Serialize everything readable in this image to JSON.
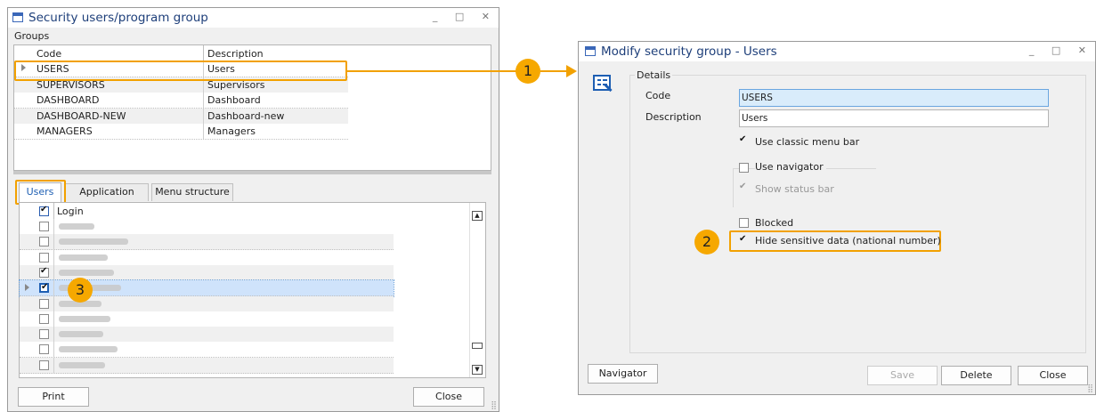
{
  "left_window": {
    "title": "Security users/program group",
    "groups_label": "Groups",
    "columns": [
      "Code",
      "Description"
    ],
    "rows": [
      {
        "code": "USERS",
        "description": "Users"
      },
      {
        "code": "SUPERVISORS",
        "description": "Supervisors"
      },
      {
        "code": "DASHBOARD",
        "description": "Dashboard"
      },
      {
        "code": "DASHBOARD-NEW",
        "description": "Dashboard-new"
      },
      {
        "code": "MANAGERS",
        "description": "Managers"
      }
    ],
    "tabs": [
      {
        "label": "Users"
      },
      {
        "label": "Application rights"
      },
      {
        "label": "Menu structure"
      }
    ],
    "users_column": "Login",
    "user_checks": [
      false,
      false,
      false,
      true,
      true,
      false,
      false,
      false,
      false,
      false
    ],
    "print_label": "Print",
    "close_label": "Close"
  },
  "right_window": {
    "title": "Modify security group - Users",
    "details_label": "Details",
    "code_label": "Code",
    "code_value": "USERS",
    "description_label": "Description",
    "description_value": "Users",
    "classic_menu_label": "Use classic menu bar",
    "classic_menu_checked": true,
    "navigator_label": "Use navigator",
    "navigator_checked": false,
    "status_bar_label": "Show status bar",
    "status_bar_checked": true,
    "blocked_label": "Blocked",
    "blocked_checked": false,
    "hide_sensitive_label": "Hide sensitive data (national number)",
    "hide_sensitive_checked": true,
    "navigator_button": "Navigator",
    "save_button": "Save",
    "delete_button": "Delete",
    "close_button": "Close"
  },
  "callouts": {
    "one": "1",
    "two": "2",
    "three": "3"
  },
  "colors": {
    "accent": "#f2a100",
    "title": "#1e3f7a",
    "selection": "#cfe3fb"
  }
}
